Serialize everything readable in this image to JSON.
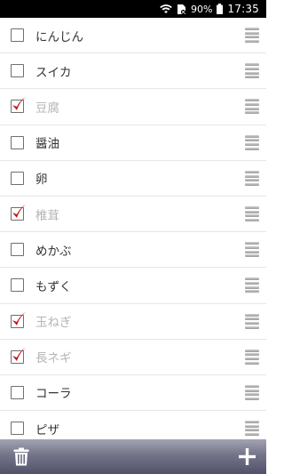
{
  "status": {
    "battery": "90%",
    "time": "17:35",
    "icons": [
      "wifi-icon",
      "sim-icon",
      "battery-icon"
    ]
  },
  "items": [
    {
      "label": "にんじん",
      "checked": false
    },
    {
      "label": "スイカ",
      "checked": false
    },
    {
      "label": "豆腐",
      "checked": true
    },
    {
      "label": "醤油",
      "checked": false
    },
    {
      "label": "卵",
      "checked": false
    },
    {
      "label": "椎茸",
      "checked": true
    },
    {
      "label": "めかぶ",
      "checked": false
    },
    {
      "label": "もずく",
      "checked": false
    },
    {
      "label": "玉ねぎ",
      "checked": true
    },
    {
      "label": "長ネギ",
      "checked": true
    },
    {
      "label": "コーラ",
      "checked": false
    },
    {
      "label": "ピザ",
      "checked": false
    }
  ],
  "toolbar": {
    "left_icon": "trash-icon",
    "right_icon": "plus-icon"
  },
  "colors": {
    "check": "#c0161b",
    "checked_text": "#b4b4b4",
    "toolbar": "#6b6b80"
  }
}
